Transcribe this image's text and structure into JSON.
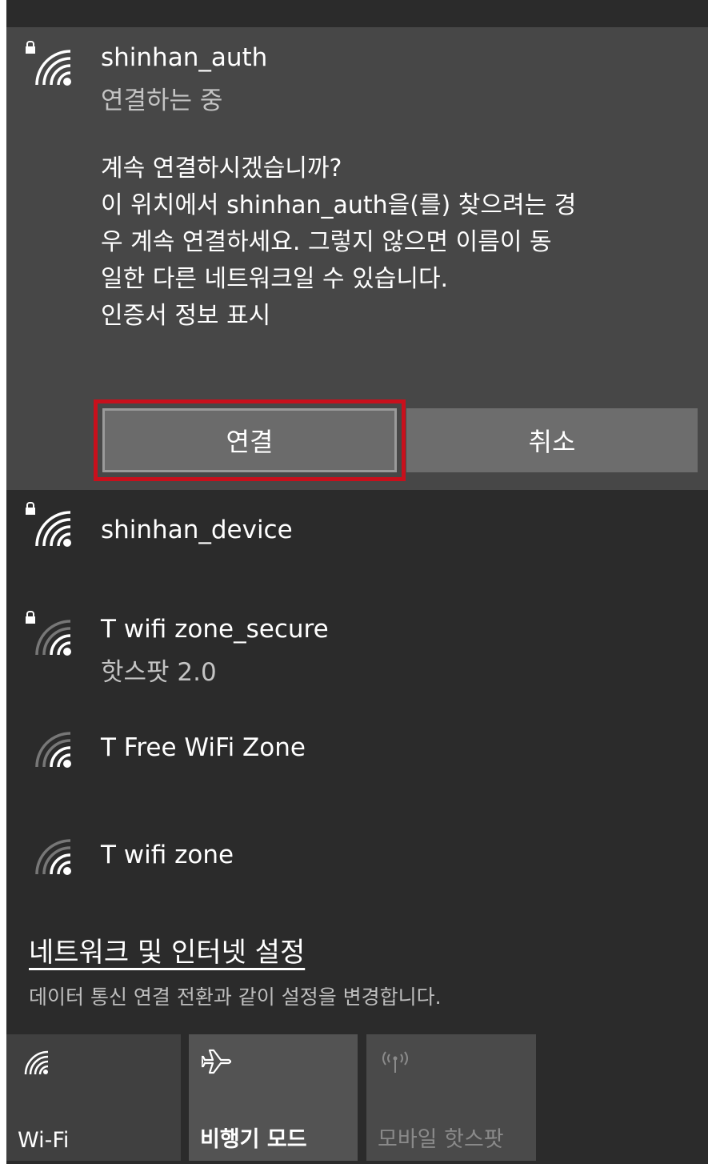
{
  "expanded_network": {
    "name": "shinhan_auth",
    "status": "연결하는 중",
    "prompt_lines": [
      "계속 연결하시겠습니까?",
      "이 위치에서 shinhan_auth을(를) 찾으려는 경",
      "우 계속 연결하세요. 그렇지 않으면 이름이 동",
      "일한 다른 네트워크일 수 있습니다.",
      "인증서 정보 표시"
    ],
    "connect_label": "연결",
    "cancel_label": "취소"
  },
  "networks": [
    {
      "name": "shinhan_device",
      "status": "",
      "secured": true
    },
    {
      "name": "T wifi zone_secure",
      "status": "핫스팟 2.0",
      "secured": true
    },
    {
      "name": "T Free WiFi Zone",
      "status": "",
      "secured": false
    },
    {
      "name": "T wifi zone",
      "status": "",
      "secured": false
    }
  ],
  "settings": {
    "link_label": "네트워크 및 인터넷 설정",
    "description": "데이터 통신 연결 전환과 같이 설정을 변경합니다."
  },
  "quick_actions": [
    {
      "label": "Wi-Fi",
      "icon": "wifi-icon",
      "enabled": true
    },
    {
      "label": "비행기 모드",
      "icon": "airplane-icon",
      "enabled": true
    },
    {
      "label": "모바일 핫스팟",
      "icon": "mobile-hotspot-icon",
      "enabled": false
    }
  ],
  "colors": {
    "panel_bg": "#2b2b2b",
    "expanded_bg": "#474747",
    "highlight_box": "#c8101c"
  }
}
